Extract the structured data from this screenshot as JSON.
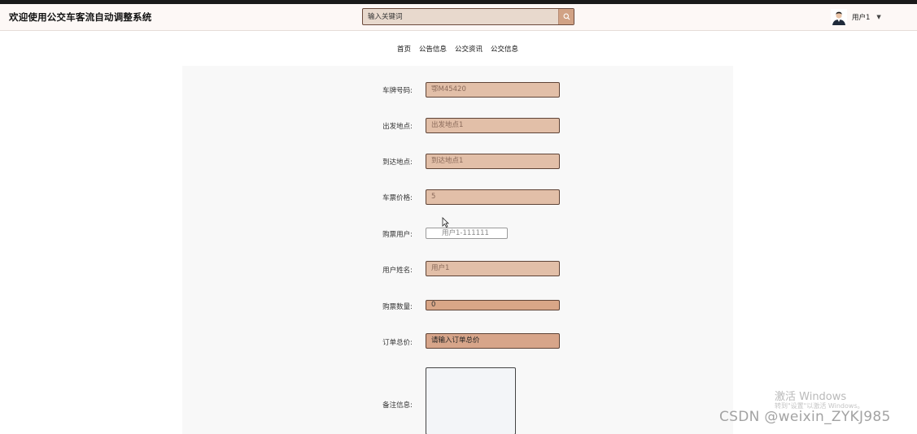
{
  "header": {
    "site_title": "欢迎使用公交车客流自动调整系统",
    "search_placeholder": "输入关键词",
    "user_name": "用户1"
  },
  "nav": {
    "items": [
      {
        "label": "首页"
      },
      {
        "label": "公告信息"
      },
      {
        "label": "公交资讯"
      },
      {
        "label": "公交信息"
      }
    ]
  },
  "form": {
    "plate": {
      "label": "车牌号码:",
      "value": "鄂M45420"
    },
    "start": {
      "label": "出发地点:",
      "value": "出发地点1"
    },
    "end": {
      "label": "到达地点:",
      "value": "到达地点1"
    },
    "price": {
      "label": "车票价格:",
      "value": "5"
    },
    "buyer": {
      "label": "购票用户:",
      "value": "用户1-111111"
    },
    "name": {
      "label": "用户姓名:",
      "value": "用户1"
    },
    "quantity": {
      "label": "购票数量:",
      "value": "0"
    },
    "total": {
      "label": "订单总价:",
      "placeholder": "请输入订单总价"
    },
    "notes": {
      "label": "备注信息:",
      "value": ""
    }
  },
  "watermark": {
    "activate_title": "激活 Windows",
    "activate_sub": "转到\"设置\"以激活 Windows。",
    "csdn": "CSDN @weixin_ZYKJ985"
  },
  "colors": {
    "accent": "#d1a285",
    "field_bg": "#e2bfa8",
    "content_bg": "#f8f8f8"
  }
}
